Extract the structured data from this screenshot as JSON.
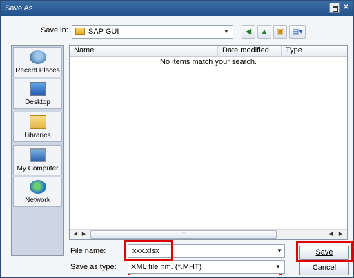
{
  "window": {
    "title": "Save As"
  },
  "toolbar": {
    "save_in_label": "Save in:",
    "save_in_value": "SAP GUI"
  },
  "places": [
    {
      "label": "Recent Places",
      "icon": "recent-places-icon"
    },
    {
      "label": "Desktop",
      "icon": "desktop-icon"
    },
    {
      "label": "Libraries",
      "icon": "libraries-icon"
    },
    {
      "label": "My Computer",
      "icon": "computer-icon"
    },
    {
      "label": "Network",
      "icon": "network-icon"
    }
  ],
  "filelist": {
    "columns": [
      "Name",
      "Date modified",
      "Type"
    ],
    "empty_message": "No items match your search."
  },
  "form": {
    "file_name_label": "File name:",
    "file_name_value": "xxx.xlsx",
    "save_as_type_label": "Save as type:",
    "save_as_type_value": "XML file nm. (*.MHT)"
  },
  "buttons": {
    "save": "Save",
    "cancel": "Cancel"
  },
  "colors": {
    "titlebar": "#2d5f9a",
    "highlight": "#e00000"
  }
}
